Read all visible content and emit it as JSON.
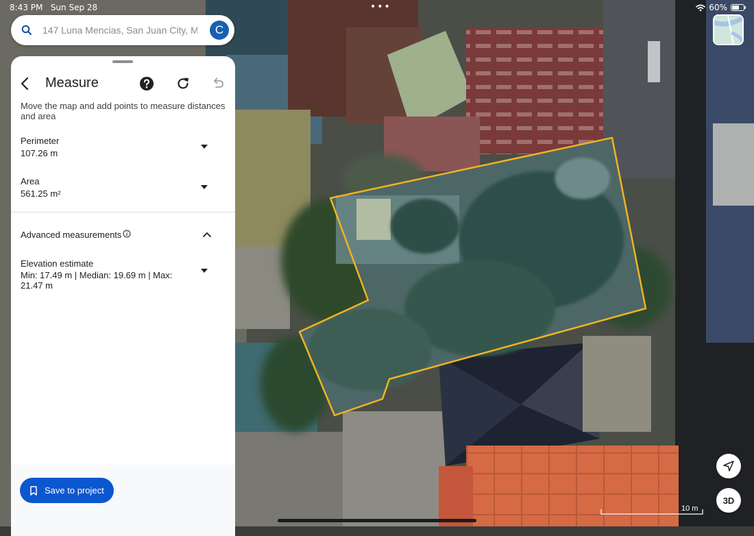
{
  "status_bar": {
    "time": "8:43 PM",
    "date": "Sun Sep 28",
    "battery": "60%",
    "battery_level": 0.6
  },
  "search": {
    "placeholder": "147 Luna Mencias, San Juan City, M",
    "avatar_initial": "C"
  },
  "panel": {
    "title": "Measure",
    "instructions": "Move the map and add points to measure distances and area",
    "perimeter": {
      "label": "Perimeter",
      "value": "107.26 m"
    },
    "area": {
      "label": "Area",
      "value": "561.25 m²"
    },
    "advanced": {
      "label": "Advanced measurements"
    },
    "elevation": {
      "label": "Elevation estimate",
      "value": "Min: 17.49 m | Median: 19.69 m | Max: 21.47 m"
    },
    "save_label": "Save to project"
  },
  "map": {
    "polygon_color": "#f2b320",
    "scale_label": "10 m",
    "btn_3d_label": "3D"
  },
  "colors": {
    "accent": "#0b57d0",
    "avatar": "#1860b0"
  },
  "icons": [
    "search-icon",
    "back-arrow-icon",
    "help-icon",
    "refresh-icon",
    "undo-icon",
    "info-icon",
    "chevron-up-icon",
    "bookmark-icon",
    "navigation-arrow-icon",
    "wifi-icon",
    "battery-icon"
  ]
}
